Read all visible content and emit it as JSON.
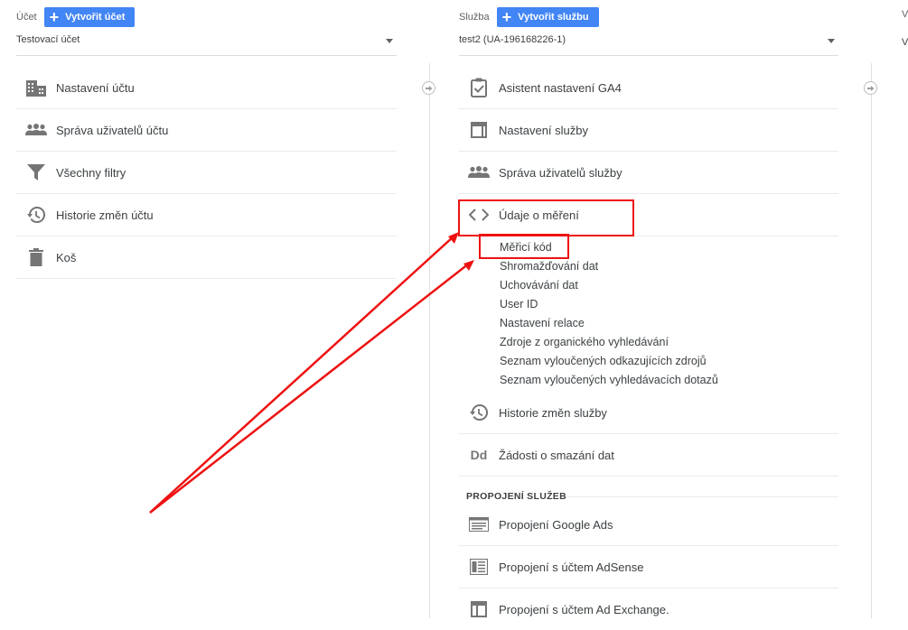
{
  "account": {
    "label": "Účet",
    "create_button": "Vytvořit účet",
    "selected": "Testovací účet",
    "items": [
      {
        "label": "Nastavení účtu",
        "icon": "building-icon"
      },
      {
        "label": "Správa uživatelů účtu",
        "icon": "people-icon"
      },
      {
        "label": "Všechny filtry",
        "icon": "filter-icon"
      },
      {
        "label": "Historie změn účtu",
        "icon": "history-icon"
      },
      {
        "label": "Koš",
        "icon": "trash-icon"
      }
    ]
  },
  "property": {
    "label": "Služba",
    "create_button": "Vytvořit službu",
    "selected": "test2 (UA-196168226-1)",
    "items": [
      {
        "label": "Asistent nastavení GA4",
        "icon": "clipboard-check-icon"
      },
      {
        "label": "Nastavení služby",
        "icon": "layout-icon"
      },
      {
        "label": "Správa uživatelů služby",
        "icon": "people-icon"
      },
      {
        "label": "Údaje o měření",
        "icon": "code-icon"
      }
    ],
    "subitems": [
      "Měřicí kód",
      "Shromažďování dat",
      "Uchovávání dat",
      "User ID",
      "Nastavení relace",
      "Zdroje z organického vyhledávání",
      "Seznam vyloučených odkazujících zdrojů",
      "Seznam vyloučených vyhledávacích dotazů"
    ],
    "items2": [
      {
        "label": "Historie změn služby",
        "icon": "history-icon"
      },
      {
        "label": "Žádosti o smazání dat",
        "icon": "dd-icon",
        "glyph": "Dd"
      }
    ],
    "section_title": "PROPOJENÍ SLUŽEB",
    "link_items": [
      {
        "label": "Propojení Google Ads",
        "icon": "ads-icon"
      },
      {
        "label": "Propojení s účtem AdSense",
        "icon": "adsense-icon"
      },
      {
        "label": "Propojení s účtem Ad Exchange.",
        "icon": "adexchange-icon"
      }
    ]
  },
  "view": {
    "label": "V",
    "selected": "V"
  },
  "colors": {
    "accent": "#4285f4",
    "highlight": "#ee1111",
    "icon": "#757575"
  }
}
